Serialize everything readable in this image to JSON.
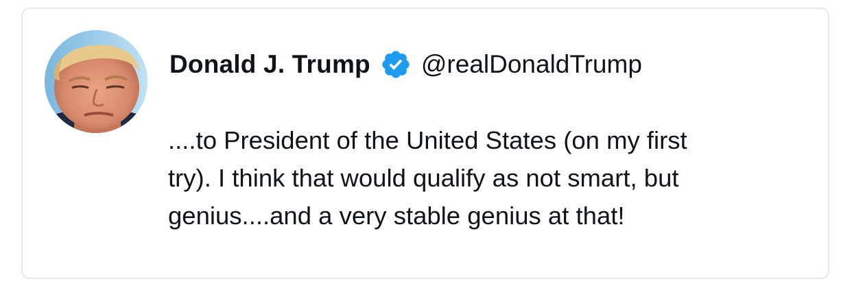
{
  "tweet": {
    "author": {
      "display_name": "Donald J. Trump",
      "handle": "@realDonaldTrump",
      "verified_icon": "verified-badge-icon",
      "verified_color": "#1d9bf0",
      "avatar": "profile-photo"
    },
    "text_lines": [
      "....to President of the United States (on my first",
      "try). I think that would qualify as not smart, but",
      "genius....and a very stable genius at that!"
    ]
  }
}
